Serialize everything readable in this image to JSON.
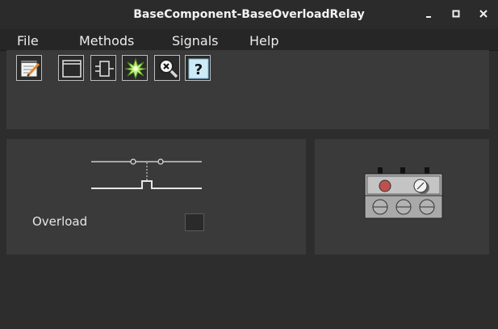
{
  "window": {
    "title": "BaseComponent-BaseOverloadRelay",
    "controls": [
      "minimize-icon",
      "maximize-icon",
      "close-icon"
    ]
  },
  "menu": {
    "items": [
      "File",
      "Methods",
      "Signals",
      "Help"
    ]
  },
  "toolbar": {
    "tools": [
      {
        "icon": "notepad-pencil-icon"
      },
      {
        "icon": "window-icon"
      },
      {
        "icon": "component-block-icon"
      },
      {
        "icon": "star-burst-icon"
      },
      {
        "icon": "magnifier-x-icon"
      },
      {
        "icon": "help-question-icon"
      }
    ]
  },
  "component": {
    "label": "Overload",
    "indicator_on": false
  },
  "colors": {
    "panel": "#3a3a3a",
    "background": "#2d2d2d",
    "relay_body": "#a9a9a9",
    "relay_button": "#c0504d"
  }
}
